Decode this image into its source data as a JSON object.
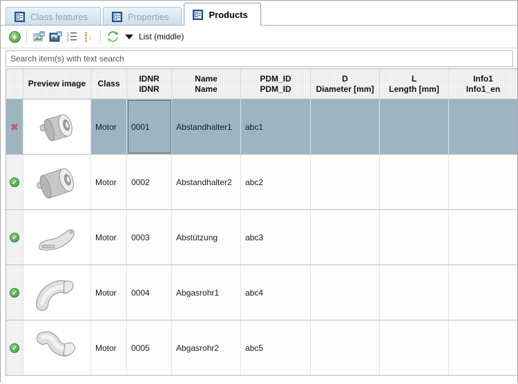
{
  "tabs": [
    {
      "label": "Class features",
      "active": false
    },
    {
      "label": "Properties",
      "active": false
    },
    {
      "label": "Products",
      "active": true
    }
  ],
  "toolbar": {
    "view_label": "List (middle)",
    "icons": [
      "add-icon",
      "image-small-icon",
      "image-large-icon",
      "numbered-list-icon",
      "sort-order-icon",
      "refresh-icon",
      "dropdown-arrow-icon"
    ]
  },
  "search": {
    "placeholder": "Search item(s) with text search"
  },
  "table": {
    "columns": [
      {
        "key": "status",
        "line1": "",
        "line2": ""
      },
      {
        "key": "preview",
        "line1": "Preview image",
        "line2": ""
      },
      {
        "key": "class",
        "line1": "Class",
        "line2": ""
      },
      {
        "key": "idnr",
        "line1": "IDNR",
        "line2": "IDNR"
      },
      {
        "key": "name",
        "line1": "Name",
        "line2": "Name"
      },
      {
        "key": "pdm_id",
        "line1": "PDM_ID",
        "line2": "PDM_ID"
      },
      {
        "key": "d",
        "line1": "D",
        "line2": "Diameter [mm]"
      },
      {
        "key": "l",
        "line1": "L",
        "line2": "Length [mm]"
      },
      {
        "key": "info1",
        "line1": "Info1",
        "line2": "Info1_en"
      }
    ],
    "rows": [
      {
        "status": "cross",
        "preview": "spacer-short-3d",
        "class": "Motor",
        "idnr": "0001",
        "name": "Abstandhalter1",
        "pdm_id": "abc1",
        "d": "",
        "l": "",
        "info1": "",
        "selected": true,
        "focused_cell": "idnr"
      },
      {
        "status": "check",
        "preview": "spacer-long-3d",
        "class": "Motor",
        "idnr": "0002",
        "name": "Abstandhalter2",
        "pdm_id": "abc2",
        "d": "",
        "l": "",
        "info1": "",
        "selected": false,
        "focused_cell": ""
      },
      {
        "status": "check",
        "preview": "support-3d",
        "class": "Motor",
        "idnr": "0003",
        "name": "Abstützung",
        "pdm_id": "abc3",
        "d": "",
        "l": "",
        "info1": "",
        "selected": false,
        "focused_cell": ""
      },
      {
        "status": "check",
        "preview": "exhaust-pipe1-3d",
        "class": "Motor",
        "idnr": "0004",
        "name": "Abgasrohr1",
        "pdm_id": "abc4",
        "d": "",
        "l": "",
        "info1": "",
        "selected": false,
        "focused_cell": ""
      },
      {
        "status": "check",
        "preview": "exhaust-pipe2-3d",
        "class": "Motor",
        "idnr": "0005",
        "name": "Abgasrohr2",
        "pdm_id": "abc5",
        "d": "",
        "l": "",
        "info1": "",
        "selected": false,
        "focused_cell": ""
      }
    ]
  },
  "colors": {
    "selection": "#9db5c3",
    "tab_inactive_text": "#93a5b4",
    "tab_icon_blue": "#2a5f9e",
    "status_green": "#3f9e45",
    "status_cross_pink": "#bf5f79",
    "refresh_green": "#3fae49"
  }
}
